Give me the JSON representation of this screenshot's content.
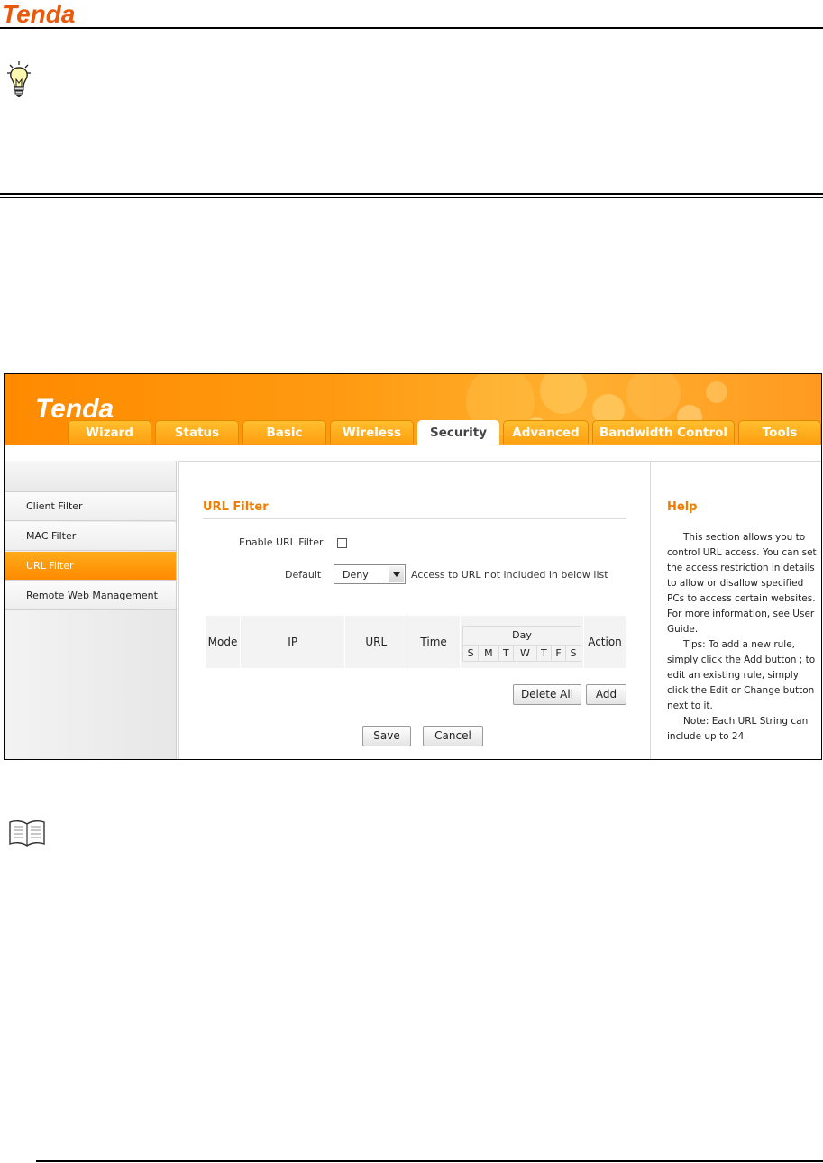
{
  "page": {
    "brand": "Tenda"
  },
  "app": {
    "brand": "Tenda",
    "tabs": [
      {
        "label": "Wizard",
        "active": false
      },
      {
        "label": "Status",
        "active": false
      },
      {
        "label": "Basic",
        "active": false
      },
      {
        "label": "Wireless",
        "active": false
      },
      {
        "label": "Security",
        "active": true
      },
      {
        "label": "Advanced",
        "active": false
      },
      {
        "label": "Bandwidth Control",
        "active": false
      },
      {
        "label": "Tools",
        "active": false
      }
    ],
    "sidebar": [
      {
        "label": "Client Filter",
        "active": false
      },
      {
        "label": "MAC Filter",
        "active": false
      },
      {
        "label": "URL Filter",
        "active": true
      },
      {
        "label": "Remote Web Management",
        "active": false
      }
    ],
    "main": {
      "title": "URL Filter",
      "enable_label": "Enable URL Filter",
      "enable_checked": false,
      "default_label": "Default",
      "default_value": "Deny",
      "default_note": "Access to URL not included in below list",
      "table": {
        "headers": [
          "Mode",
          "IP",
          "URL",
          "Time",
          "Day",
          "Action"
        ],
        "days": [
          "S",
          "M",
          "T",
          "W",
          "T",
          "F",
          "S"
        ]
      },
      "delete_all": "Delete All",
      "add": "Add",
      "save": "Save",
      "cancel": "Cancel"
    },
    "help": {
      "title": "Help",
      "paragraphs": [
        "This section allows you to control URL access. You can set the access restriction in details to allow or disallow specified PCs to access certain websites. For more information, see User Guide.",
        "Tips: To add a new rule, simply click the Add button ; to edit an existing rule, simply click the Edit or Change button next to it.",
        "Note: Each URL String can include up to 24"
      ]
    }
  },
  "colors": {
    "orange": "#ff8a00",
    "title_orange": "#f07c00",
    "tab_gold": "#ffb020"
  },
  "icons": [
    "lightbulb-icon",
    "book-icon",
    "dropdown-arrow-icon"
  ]
}
